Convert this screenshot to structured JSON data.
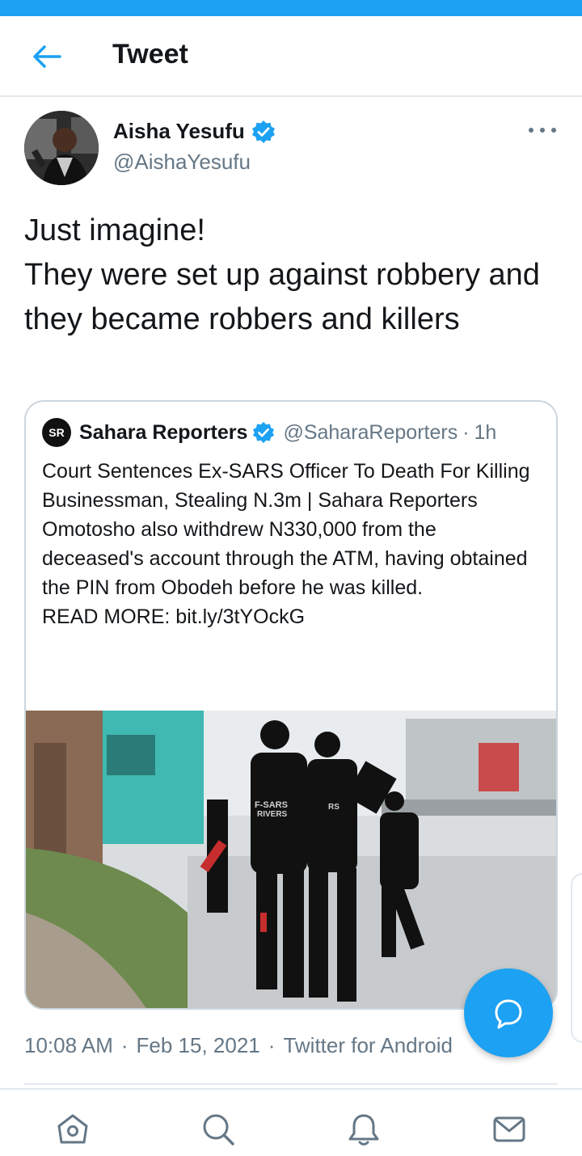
{
  "header": {
    "title": "Tweet",
    "back_icon": "arrow-left-icon"
  },
  "tweet": {
    "author": {
      "name": "Aisha Yesufu",
      "handle": "@AishaYesufu",
      "verified": true
    },
    "text": "Just imagine!\nThey were set up against robbery and they became robbers and killers",
    "quoted": {
      "logo_text": "SR",
      "author_name": "Sahara Reporters",
      "handle": "@SaharaReporters",
      "separator": "·",
      "time": "1h",
      "verified": true,
      "text": "Court Sentences Ex-SARS Officer To Death For Killing Businessman, Stealing N.3m | Sahara Reporters\nOmotosho also withdrew N330,000 from the deceased's account through the ATM, having obtained the PIN from Obodeh before he was killed.\nREAD MORE: bit.ly/3tYOckG",
      "image_patch_texts": [
        "F-SARS",
        "RIVERS",
        "RS"
      ]
    },
    "meta": {
      "time": "10:08 AM",
      "dot1": "·",
      "date": "Feb 15, 2021",
      "dot2": "·",
      "source": "Twitter for Android"
    }
  },
  "fab": {
    "icon": "reply-bubble-icon"
  },
  "bottom_nav": [
    {
      "name": "home",
      "icon": "home-icon"
    },
    {
      "name": "search",
      "icon": "search-icon"
    },
    {
      "name": "notifications",
      "icon": "bell-icon"
    },
    {
      "name": "messages",
      "icon": "mail-icon"
    }
  ],
  "colors": {
    "accent": "#1da1f2",
    "text": "#14171a",
    "secondary": "#657786",
    "border": "#e1e8ed"
  }
}
